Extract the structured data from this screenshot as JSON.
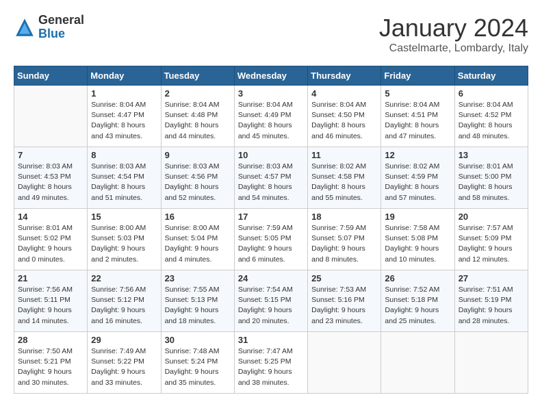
{
  "header": {
    "logo_general": "General",
    "logo_blue": "Blue",
    "month": "January 2024",
    "location": "Castelmarte, Lombardy, Italy"
  },
  "weekdays": [
    "Sunday",
    "Monday",
    "Tuesday",
    "Wednesday",
    "Thursday",
    "Friday",
    "Saturday"
  ],
  "weeks": [
    [
      {
        "day": "",
        "empty": true
      },
      {
        "day": "1",
        "sunrise": "Sunrise: 8:04 AM",
        "sunset": "Sunset: 4:47 PM",
        "daylight": "Daylight: 8 hours and 43 minutes."
      },
      {
        "day": "2",
        "sunrise": "Sunrise: 8:04 AM",
        "sunset": "Sunset: 4:48 PM",
        "daylight": "Daylight: 8 hours and 44 minutes."
      },
      {
        "day": "3",
        "sunrise": "Sunrise: 8:04 AM",
        "sunset": "Sunset: 4:49 PM",
        "daylight": "Daylight: 8 hours and 45 minutes."
      },
      {
        "day": "4",
        "sunrise": "Sunrise: 8:04 AM",
        "sunset": "Sunset: 4:50 PM",
        "daylight": "Daylight: 8 hours and 46 minutes."
      },
      {
        "day": "5",
        "sunrise": "Sunrise: 8:04 AM",
        "sunset": "Sunset: 4:51 PM",
        "daylight": "Daylight: 8 hours and 47 minutes."
      },
      {
        "day": "6",
        "sunrise": "Sunrise: 8:04 AM",
        "sunset": "Sunset: 4:52 PM",
        "daylight": "Daylight: 8 hours and 48 minutes."
      }
    ],
    [
      {
        "day": "7",
        "sunrise": "Sunrise: 8:03 AM",
        "sunset": "Sunset: 4:53 PM",
        "daylight": "Daylight: 8 hours and 49 minutes."
      },
      {
        "day": "8",
        "sunrise": "Sunrise: 8:03 AM",
        "sunset": "Sunset: 4:54 PM",
        "daylight": "Daylight: 8 hours and 51 minutes."
      },
      {
        "day": "9",
        "sunrise": "Sunrise: 8:03 AM",
        "sunset": "Sunset: 4:56 PM",
        "daylight": "Daylight: 8 hours and 52 minutes."
      },
      {
        "day": "10",
        "sunrise": "Sunrise: 8:03 AM",
        "sunset": "Sunset: 4:57 PM",
        "daylight": "Daylight: 8 hours and 54 minutes."
      },
      {
        "day": "11",
        "sunrise": "Sunrise: 8:02 AM",
        "sunset": "Sunset: 4:58 PM",
        "daylight": "Daylight: 8 hours and 55 minutes."
      },
      {
        "day": "12",
        "sunrise": "Sunrise: 8:02 AM",
        "sunset": "Sunset: 4:59 PM",
        "daylight": "Daylight: 8 hours and 57 minutes."
      },
      {
        "day": "13",
        "sunrise": "Sunrise: 8:01 AM",
        "sunset": "Sunset: 5:00 PM",
        "daylight": "Daylight: 8 hours and 58 minutes."
      }
    ],
    [
      {
        "day": "14",
        "sunrise": "Sunrise: 8:01 AM",
        "sunset": "Sunset: 5:02 PM",
        "daylight": "Daylight: 9 hours and 0 minutes."
      },
      {
        "day": "15",
        "sunrise": "Sunrise: 8:00 AM",
        "sunset": "Sunset: 5:03 PM",
        "daylight": "Daylight: 9 hours and 2 minutes."
      },
      {
        "day": "16",
        "sunrise": "Sunrise: 8:00 AM",
        "sunset": "Sunset: 5:04 PM",
        "daylight": "Daylight: 9 hours and 4 minutes."
      },
      {
        "day": "17",
        "sunrise": "Sunrise: 7:59 AM",
        "sunset": "Sunset: 5:05 PM",
        "daylight": "Daylight: 9 hours and 6 minutes."
      },
      {
        "day": "18",
        "sunrise": "Sunrise: 7:59 AM",
        "sunset": "Sunset: 5:07 PM",
        "daylight": "Daylight: 9 hours and 8 minutes."
      },
      {
        "day": "19",
        "sunrise": "Sunrise: 7:58 AM",
        "sunset": "Sunset: 5:08 PM",
        "daylight": "Daylight: 9 hours and 10 minutes."
      },
      {
        "day": "20",
        "sunrise": "Sunrise: 7:57 AM",
        "sunset": "Sunset: 5:09 PM",
        "daylight": "Daylight: 9 hours and 12 minutes."
      }
    ],
    [
      {
        "day": "21",
        "sunrise": "Sunrise: 7:56 AM",
        "sunset": "Sunset: 5:11 PM",
        "daylight": "Daylight: 9 hours and 14 minutes."
      },
      {
        "day": "22",
        "sunrise": "Sunrise: 7:56 AM",
        "sunset": "Sunset: 5:12 PM",
        "daylight": "Daylight: 9 hours and 16 minutes."
      },
      {
        "day": "23",
        "sunrise": "Sunrise: 7:55 AM",
        "sunset": "Sunset: 5:13 PM",
        "daylight": "Daylight: 9 hours and 18 minutes."
      },
      {
        "day": "24",
        "sunrise": "Sunrise: 7:54 AM",
        "sunset": "Sunset: 5:15 PM",
        "daylight": "Daylight: 9 hours and 20 minutes."
      },
      {
        "day": "25",
        "sunrise": "Sunrise: 7:53 AM",
        "sunset": "Sunset: 5:16 PM",
        "daylight": "Daylight: 9 hours and 23 minutes."
      },
      {
        "day": "26",
        "sunrise": "Sunrise: 7:52 AM",
        "sunset": "Sunset: 5:18 PM",
        "daylight": "Daylight: 9 hours and 25 minutes."
      },
      {
        "day": "27",
        "sunrise": "Sunrise: 7:51 AM",
        "sunset": "Sunset: 5:19 PM",
        "daylight": "Daylight: 9 hours and 28 minutes."
      }
    ],
    [
      {
        "day": "28",
        "sunrise": "Sunrise: 7:50 AM",
        "sunset": "Sunset: 5:21 PM",
        "daylight": "Daylight: 9 hours and 30 minutes."
      },
      {
        "day": "29",
        "sunrise": "Sunrise: 7:49 AM",
        "sunset": "Sunset: 5:22 PM",
        "daylight": "Daylight: 9 hours and 33 minutes."
      },
      {
        "day": "30",
        "sunrise": "Sunrise: 7:48 AM",
        "sunset": "Sunset: 5:24 PM",
        "daylight": "Daylight: 9 hours and 35 minutes."
      },
      {
        "day": "31",
        "sunrise": "Sunrise: 7:47 AM",
        "sunset": "Sunset: 5:25 PM",
        "daylight": "Daylight: 9 hours and 38 minutes."
      },
      {
        "day": "",
        "empty": true
      },
      {
        "day": "",
        "empty": true
      },
      {
        "day": "",
        "empty": true
      }
    ]
  ]
}
